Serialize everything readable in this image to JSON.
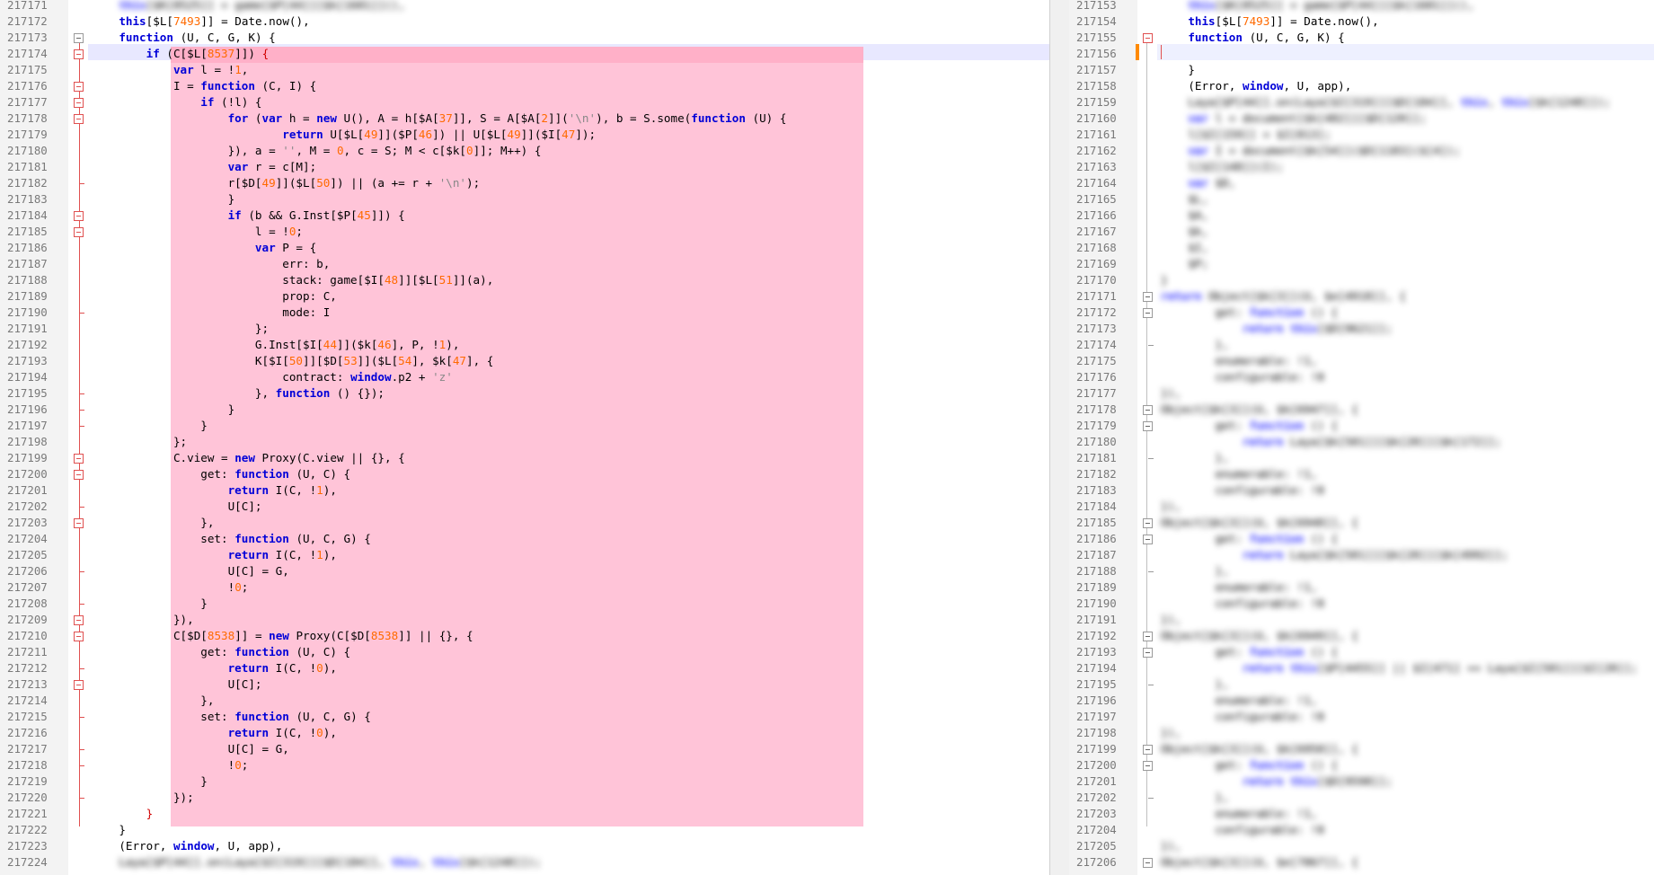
{
  "left": {
    "line_numbers": [
      "217171",
      "217172",
      "217173",
      "217174",
      "217175",
      "217176",
      "217177",
      "217178",
      "217179",
      "217180",
      "217181",
      "217182",
      "217183",
      "217184",
      "217185",
      "217186",
      "217187",
      "217188",
      "217189",
      "217190",
      "217191",
      "217192",
      "217193",
      "217194",
      "217195",
      "217196",
      "217197",
      "217198",
      "217199",
      "217200",
      "217201",
      "217202",
      "217203",
      "217204",
      "217205",
      "217206",
      "217207",
      "217208",
      "217209",
      "217210",
      "217211",
      "217212",
      "217213",
      "217214",
      "217215",
      "217216",
      "217217",
      "217218",
      "217219",
      "217220",
      "217221",
      "217222",
      "217223",
      "217224"
    ],
    "lines": [
      "this[$L[7493]] = Date.now(),",
      "function (U, C, G, K) {",
      "if (C[$L[8537]]) {",
      "var l = !1,",
      "I = function (C, I) {",
      "if (!l) {",
      "for (var h = new U(), A = h[$A[37]], S = A[$A[2]]('\\n'), b = S.some(function (U) {",
      "return U[$L[49]]($P[46]) || U[$L[49]]($I[47]);",
      "}), a = '', M = 0, c = S; M < c[$k[0]]; M++) {",
      "var r = c[M];",
      "r[$D[49]]($L[50]) || (a += r + '\\n');",
      "}",
      "if (b && G.Inst[$P[45]]) {",
      "l = !0;",
      "var P = {",
      "err: b,",
      "stack: game[$I[48]][$L[51]](a),",
      "prop: C,",
      "mode: I",
      "};",
      "G.Inst[$I[44]]($k[46], P, !1),",
      "K[$I[50]][$D[53]]($L[54], $k[47], {",
      "contract: window.p2 + 'z'",
      "}, function () {});",
      "}",
      "}",
      "};",
      "C.view = new Proxy(C.view || {}, {",
      "get: function (U, C) {",
      "return I(C, !1),",
      "U[C];",
      "},",
      "set: function (U, C, G) {",
      "return I(C, !1),",
      "U[C] = G,",
      "!0;",
      "}",
      "}),",
      "C[$D[8538]] = new Proxy(C[$D[8538]] || {}, {",
      "get: function (U, C) {",
      "return I(C, !0),",
      "U[C];",
      "},",
      "set: function (U, C, G) {",
      "return I(C, !0),",
      "U[C] = G,",
      "!0;",
      "}",
      "});",
      "}",
      "}",
      "(Error, window, U, app),"
    ]
  },
  "right": {
    "line_numbers": [
      "217153",
      "217154",
      "217155",
      "217156",
      "217157",
      "217158",
      "217159",
      "217160",
      "217161",
      "217162",
      "217163",
      "217164",
      "217165",
      "217166",
      "217167",
      "217168",
      "217169",
      "217170",
      "217171",
      "217172",
      "217173",
      "217174",
      "217175",
      "217176",
      "217177",
      "217178",
      "217179",
      "217180",
      "217181",
      "217182",
      "217183",
      "217184",
      "217185",
      "217186",
      "217187",
      "217188",
      "217189",
      "217190",
      "217191",
      "217192",
      "217193",
      "217194",
      "217195",
      "217196",
      "217197",
      "217198",
      "217199",
      "217200",
      "217201",
      "217202",
      "217203",
      "217204",
      "217205",
      "217206"
    ],
    "lines": [
      "this[$L[7493]] = Date.now(),",
      "function (U, C, G, K) {",
      "}",
      "(Error, window, U, app),"
    ]
  },
  "colors": {
    "diff_block": "#ffc4d8",
    "keyword": "#0000d8",
    "number": "#ff6a00",
    "line_number": "#7a7a7a"
  }
}
